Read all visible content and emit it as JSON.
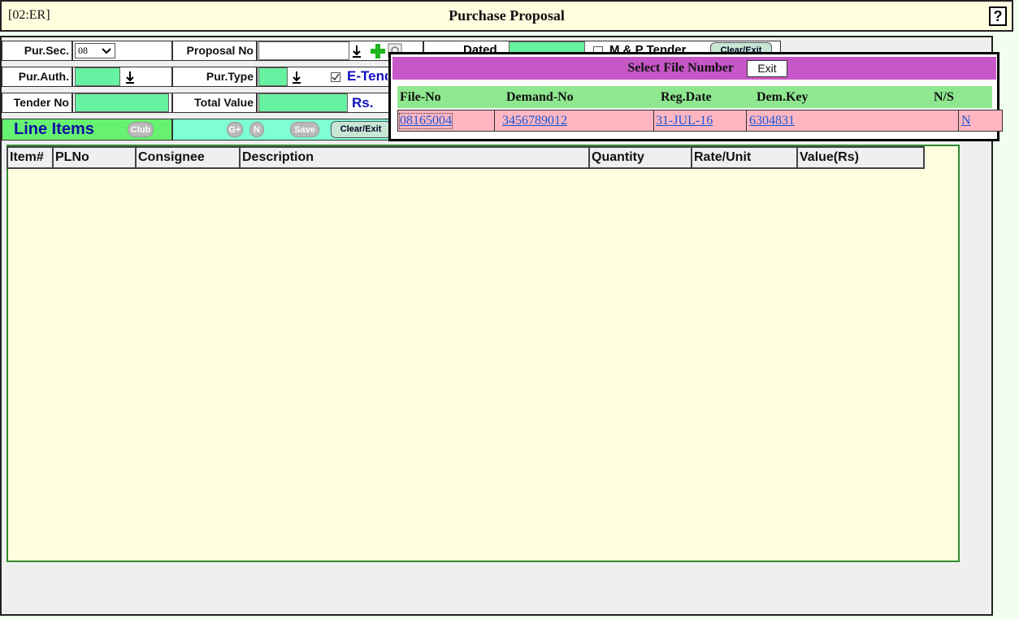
{
  "header": {
    "code": "[02:ER]",
    "title": "Purchase Proposal",
    "help": "?"
  },
  "form": {
    "pur_sec": {
      "label": "Pur.Sec.",
      "value": "08",
      "dropdown_icon": "chevron-down-icon"
    },
    "proposal_no": {
      "label": "Proposal No",
      "value": ""
    },
    "dated": {
      "label": "Dated"
    },
    "mp_tender": {
      "label": "M & P Tender",
      "checked": false
    },
    "pur_auth": {
      "label": "Pur.Auth."
    },
    "pur_type": {
      "label": "Pur.Type"
    },
    "e_tender": {
      "label": "E-Tender",
      "checked": true
    },
    "tender_no": {
      "label": "Tender No"
    },
    "total_value": {
      "label": "Total Value",
      "unit": "Rs."
    },
    "line_items": {
      "label": "Line Items"
    }
  },
  "buttons": {
    "clear_exit_top": "Clear/Exit",
    "club": "Club",
    "gplus": "G+",
    "n": "N",
    "save": "Save",
    "clear_exit": "Clear/Exit"
  },
  "items_grid": {
    "columns": [
      "Item#",
      "PLNo",
      "Consignee",
      "Description",
      "Quantity",
      "Rate/Unit",
      "Value(Rs)"
    ]
  },
  "popup": {
    "title": "Select File Number",
    "exit": "Exit",
    "columns": [
      "File-No",
      "Demand-No",
      "Reg.Date",
      "Dem.Key",
      "N/S"
    ],
    "rows": [
      {
        "file_no": "08165004",
        "demand_no": "3456789012",
        "reg_date": "31-JUL-16",
        "dem_key": "6304831",
        "ns": "N"
      }
    ]
  },
  "colors": {
    "header_bg": "#ffffe0",
    "field_green": "#66f2a0",
    "popup_title": "#c757c7",
    "popup_header": "#8fe88f",
    "row_pink": "#ffb6c1"
  }
}
